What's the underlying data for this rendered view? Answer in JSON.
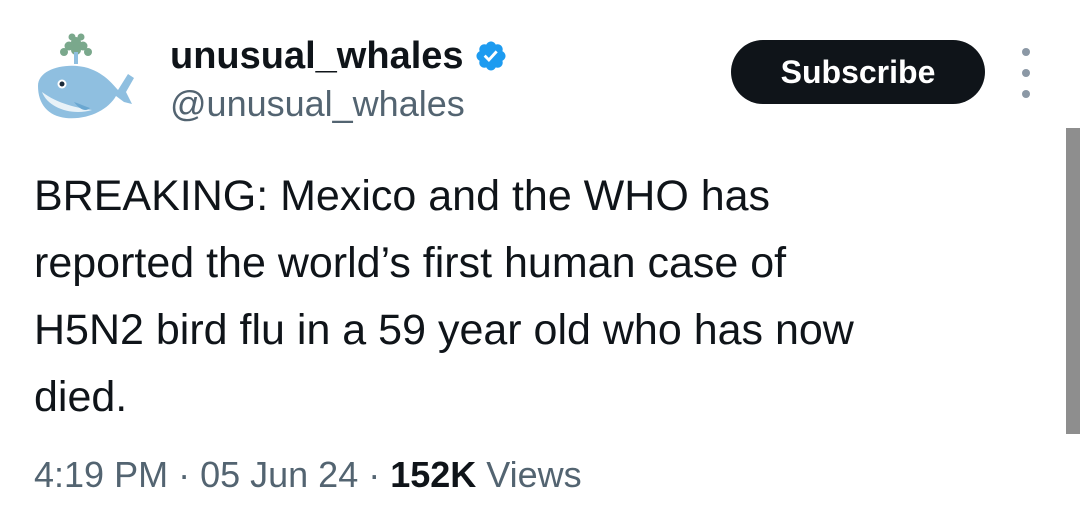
{
  "author": {
    "display_name": "unusual_whales",
    "handle": "@unusual_whales",
    "avatar_icon": "whale-icon",
    "verified_icon": "verified-badge-icon"
  },
  "actions": {
    "subscribe_label": "Subscribe",
    "more_icon": "more-options-icon"
  },
  "tweet": {
    "text": "BREAKING: Mexico and the WHO has\nreported the world’s first human case of\nH5N2 bird flu in a 59 year old who has now\ndied.",
    "time": "4:19 PM",
    "separator": " · ",
    "date": "05 Jun 24",
    "views_count": "152K",
    "views_label": " Views"
  },
  "colors": {
    "text": "#0f1419",
    "secondary": "#536471",
    "verified": "#1d9bf0",
    "whale": "#8fbfe0",
    "spout": "#7aa88c"
  }
}
